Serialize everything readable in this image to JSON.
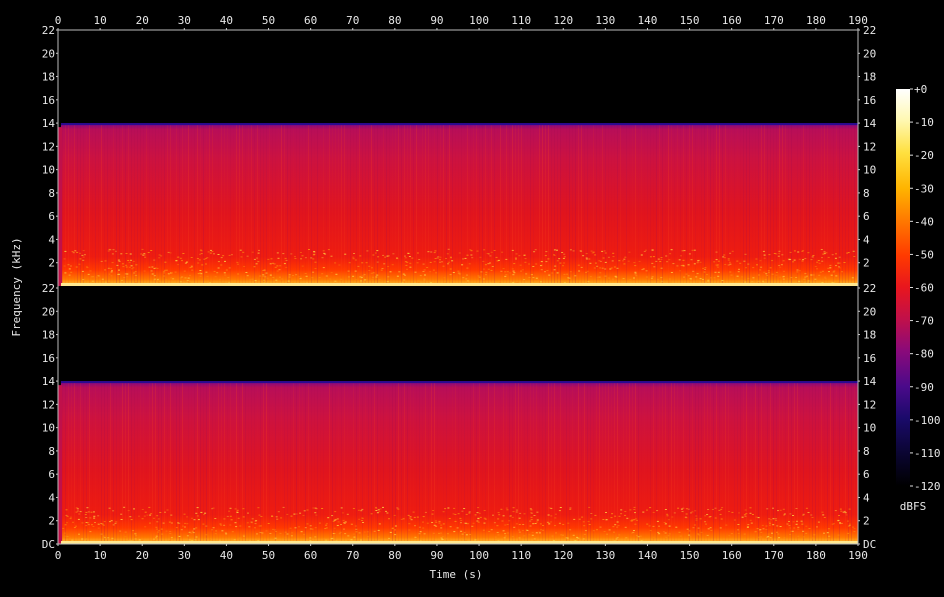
{
  "chart_data": {
    "type": "heatmap",
    "title": "",
    "xlabel": "Time (s)",
    "ylabel": "Frequency (kHz)",
    "xlim": [
      0,
      190
    ],
    "x_ticks": [
      0,
      10,
      20,
      30,
      40,
      50,
      60,
      70,
      80,
      90,
      100,
      110,
      120,
      130,
      140,
      150,
      160,
      170,
      180,
      190
    ],
    "channels": [
      {
        "ylim": [
          0,
          22
        ],
        "y_ticks_left": [
          "22",
          "20",
          "18",
          "16",
          "14",
          "12",
          "10",
          "8",
          "6",
          "4",
          "2"
        ],
        "y_ticks_right": [
          "22",
          "20",
          "18",
          "16",
          "14",
          "12",
          "10",
          "8",
          "6",
          "4",
          "2"
        ],
        "cutoff_khz": 14
      },
      {
        "ylim": [
          0,
          22
        ],
        "y_ticks_left": [
          "22",
          "20",
          "18",
          "16",
          "14",
          "12",
          "10",
          "8",
          "6",
          "4",
          "2",
          "DC"
        ],
        "y_ticks_right": [
          "22",
          "20",
          "18",
          "16",
          "14",
          "12",
          "10",
          "8",
          "6",
          "4",
          "2",
          "DC"
        ],
        "cutoff_khz": 14
      }
    ],
    "colorbar": {
      "label": "dBFS",
      "ticks": [
        "+0",
        "-10",
        "-20",
        "-30",
        "-40",
        "-50",
        "-60",
        "-70",
        "-80",
        "-90",
        "-100",
        "-110",
        "-120"
      ],
      "range": [
        -120,
        0
      ],
      "colors": [
        "#000000",
        "#0a0530",
        "#1a0a6a",
        "#4a0a8a",
        "#8a0a7a",
        "#c0104a",
        "#e8161e",
        "#ff3a00",
        "#ff7a00",
        "#ffb400",
        "#ffe040",
        "#fff8b0",
        "#ffffff"
      ]
    },
    "grid": false
  }
}
